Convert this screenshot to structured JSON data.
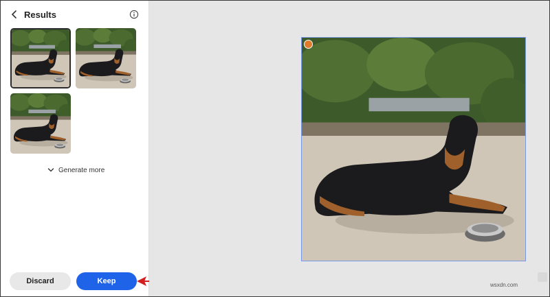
{
  "panel": {
    "title": "Results",
    "generate_more_label": "Generate more",
    "discard_label": "Discard",
    "keep_label": "Keep"
  },
  "results": [
    {
      "index": 1,
      "selected": true
    },
    {
      "index": 2,
      "selected": false
    },
    {
      "index": 3,
      "selected": false
    }
  ],
  "watermark": {
    "text": "wsxdn.com"
  },
  "icons": {
    "back": "chevron-left-icon",
    "info": "info-icon",
    "expand": "chevron-down-icon",
    "annotation": "red-arrow"
  },
  "colors": {
    "keep_button": "#1f64e8",
    "discard_button": "#e8e8e8",
    "selection_outline": "#7897e6",
    "arrow": "#d21f1f"
  }
}
